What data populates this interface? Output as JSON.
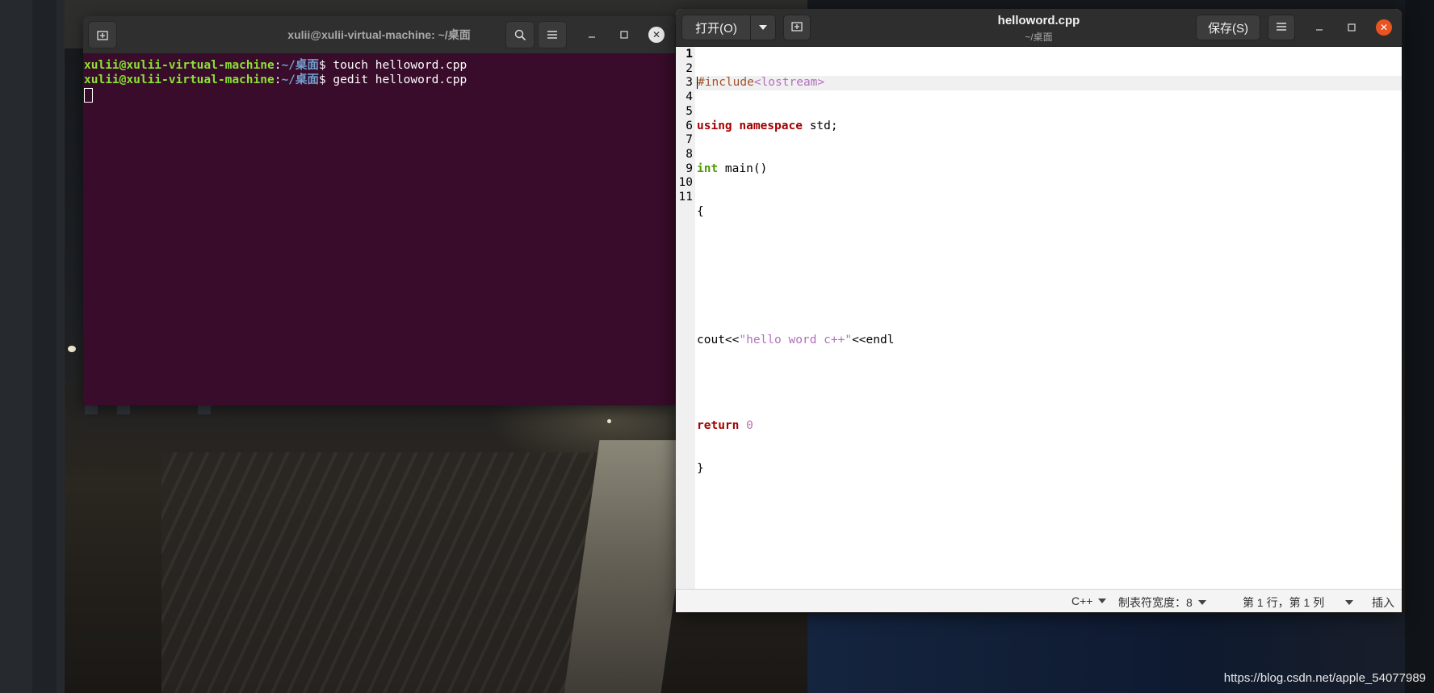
{
  "terminal": {
    "title": "xulii@xulii-virtual-machine: ~/桌面",
    "lines": [
      {
        "user": "xulii@xulii-virtual-machine",
        "sep": ":",
        "path": "~/桌面",
        "cmd": "$ touch helloword.cpp"
      },
      {
        "user": "xulii@xulii-virtual-machine",
        "sep": ":",
        "path": "~/桌面",
        "cmd": "$ gedit helloword.cpp"
      }
    ],
    "icons": {
      "new_tab": "new-tab-icon",
      "search": "search-icon",
      "menu": "hamburger-menu-icon",
      "minimize": "minimize-icon",
      "maximize": "maximize-icon",
      "close": "close-icon"
    }
  },
  "gedit": {
    "open_label": "打开(O)",
    "save_label": "保存(S)",
    "filename": "helloword.cpp",
    "filepath": "~/桌面",
    "line_numbers": [
      "1",
      "2",
      "3",
      "4",
      "5",
      "6",
      "7",
      "8",
      "9",
      "10",
      "11"
    ],
    "code": {
      "l1_a": "#include",
      "l1_b": "<lostream>",
      "l2_a": "using",
      "l2_b": "namespace",
      "l2_c": " std;",
      "l3_a": "int",
      "l3_b": " main()",
      "l4": "{",
      "l7_a": "cout<<",
      "l7_b": "\"hello word c++\"",
      "l7_c": "<<endl",
      "l9_a": "return",
      "l9_b": "0",
      "l10": "}"
    },
    "status": {
      "language": "C++",
      "tab_width": "制表符宽度：8",
      "position": "第 1 行，第 1 列",
      "mode": "插入"
    }
  },
  "watermark": "https://blog.csdn.net/apple_54077989",
  "colors": {
    "terminal_bg": "#380c2a",
    "close_button": "#e95420",
    "prompt_user": "#8ae234",
    "prompt_path": "#729fcf"
  }
}
